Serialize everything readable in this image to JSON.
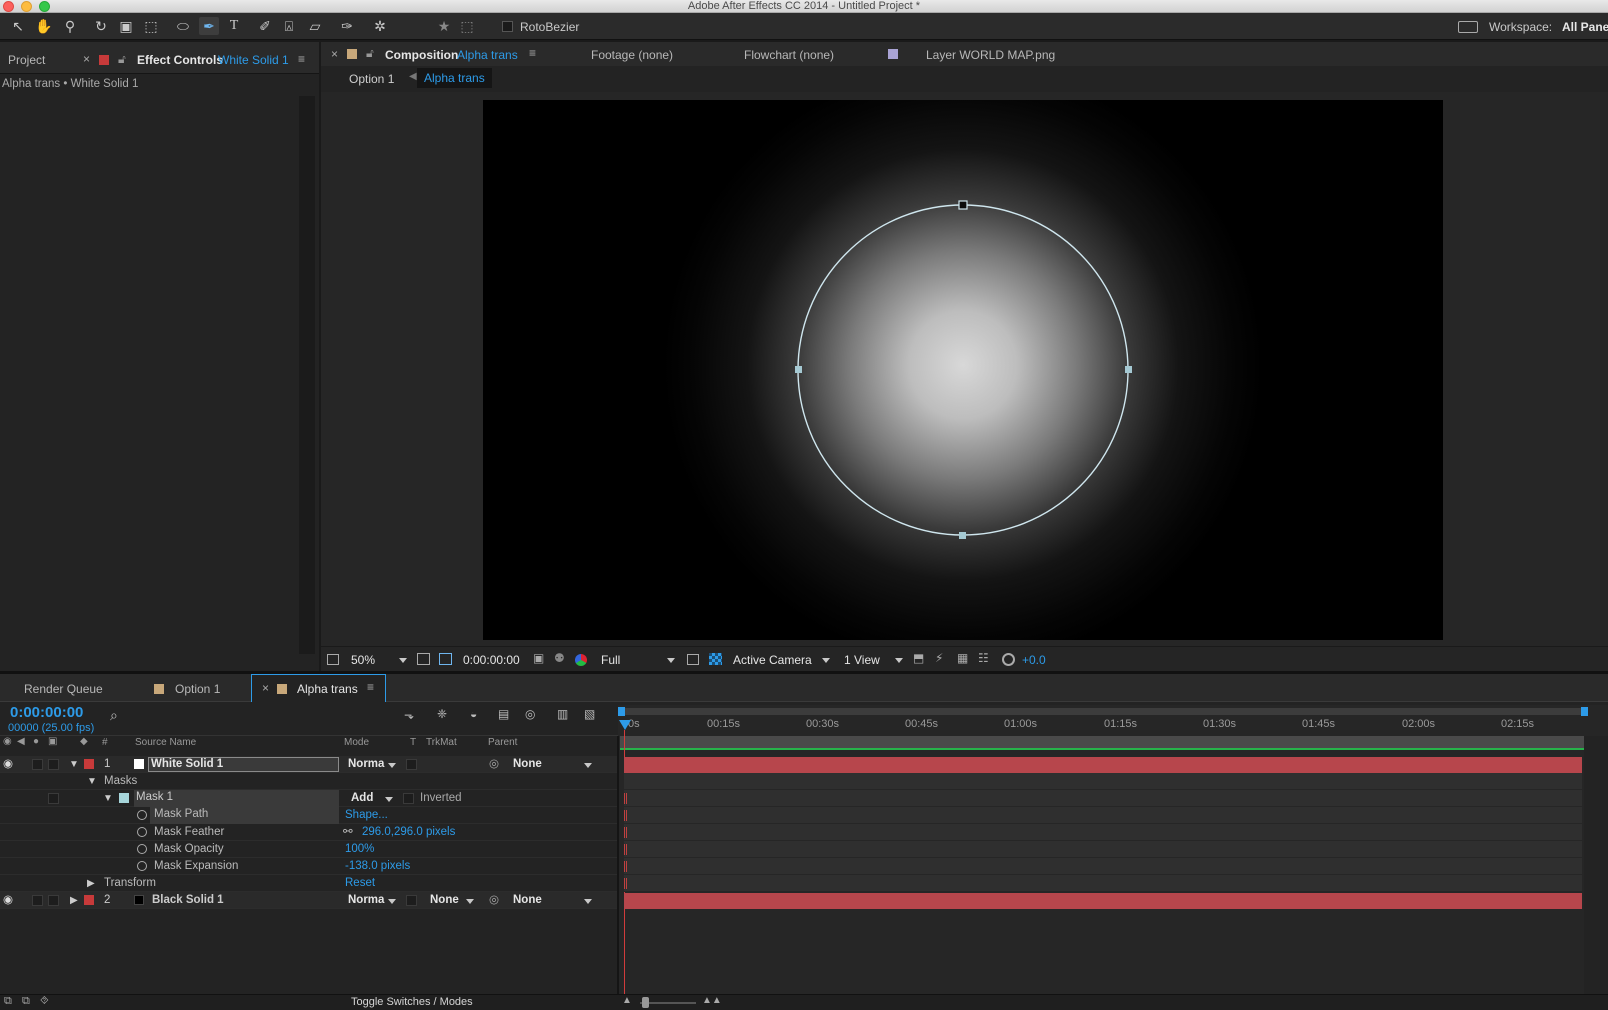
{
  "app": {
    "window_title": "Adobe After Effects CC 2014 - Untitled Project *"
  },
  "toolbar": {
    "rotobezier_label": "RotoBezier",
    "workspace_label": "Workspace:",
    "workspace_value": "All Panel"
  },
  "left_panel": {
    "project_tab": "Project",
    "effect_controls_tab": "Effect Controls",
    "effect_controls_layer": "White Solid 1",
    "breadcrumb": "Alpha trans • White Solid 1"
  },
  "viewer": {
    "composition_tab": "Composition",
    "composition_name": "Alpha trans",
    "footage_tab": "Footage (none)",
    "flowchart_tab": "Flowchart (none)",
    "layer_tab": "Layer WORLD MAP.png",
    "nav_crumbs": [
      "Option 1",
      "Alpha trans"
    ],
    "zoom": "50%",
    "timecode": "0:00:00:00",
    "resolution": "Full",
    "camera": "Active Camera",
    "views": "1 View",
    "exposure": "+0.0"
  },
  "timeline": {
    "tabs": [
      "Render Queue",
      "Option 1",
      "Alpha trans"
    ],
    "current_time": "0:00:00:00",
    "frame_info": "00000 (25.00 fps)",
    "columns": {
      "num": "#",
      "source_name": "Source Name",
      "mode": "Mode",
      "t": "T",
      "trkmat": "TrkMat",
      "parent": "Parent"
    },
    "ruler_labels": [
      "0s",
      "00:15s",
      "00:30s",
      "00:45s",
      "01:00s",
      "01:15s",
      "01:30s",
      "01:45s",
      "02:00s",
      "02:15s"
    ],
    "layers": [
      {
        "num": "1",
        "name": "White Solid 1",
        "mode": "Norma",
        "trkmat": "",
        "parent": "None"
      },
      {
        "num": "2",
        "name": "Black Solid 1",
        "mode": "Norma",
        "trkmat": "None",
        "parent": "None"
      }
    ],
    "masks_group": "Masks",
    "mask": {
      "name": "Mask 1",
      "mode": "Add",
      "inverted_label": "Inverted",
      "properties": [
        {
          "name": "Mask Path",
          "value": "Shape..."
        },
        {
          "name": "Mask Feather",
          "value": "296.0,296.0 pixels"
        },
        {
          "name": "Mask Opacity",
          "value": "100%"
        },
        {
          "name": "Mask Expansion",
          "value": "-138.0 pixels"
        }
      ]
    },
    "transform_label": "Transform",
    "transform_value": "Reset",
    "toggle_label": "Toggle Switches / Modes"
  },
  "colors": {
    "accent_blue": "#2d9be8",
    "layer_bar_red": "#b7464c",
    "label_red": "#c73a3a",
    "panel_bg": "#232323"
  }
}
